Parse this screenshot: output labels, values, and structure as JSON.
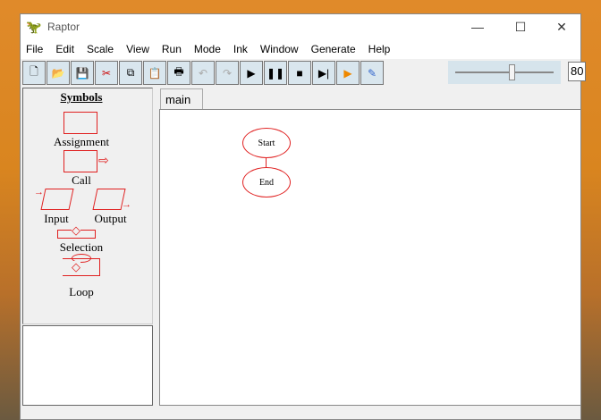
{
  "window": {
    "title": "Raptor"
  },
  "menu": [
    "File",
    "Edit",
    "Scale",
    "View",
    "Run",
    "Mode",
    "Ink",
    "Window",
    "Generate",
    "Help"
  ],
  "toolbar": {
    "zoom_value": "80"
  },
  "symbols": {
    "heading": "Symbols",
    "assignment": "Assignment",
    "call": "Call",
    "input": "Input",
    "output": "Output",
    "selection": "Selection",
    "loop": "Loop"
  },
  "tabs": [
    "main"
  ],
  "flowchart": {
    "start": "Start",
    "end": "End"
  },
  "colors": {
    "symbol": "#e02020"
  }
}
